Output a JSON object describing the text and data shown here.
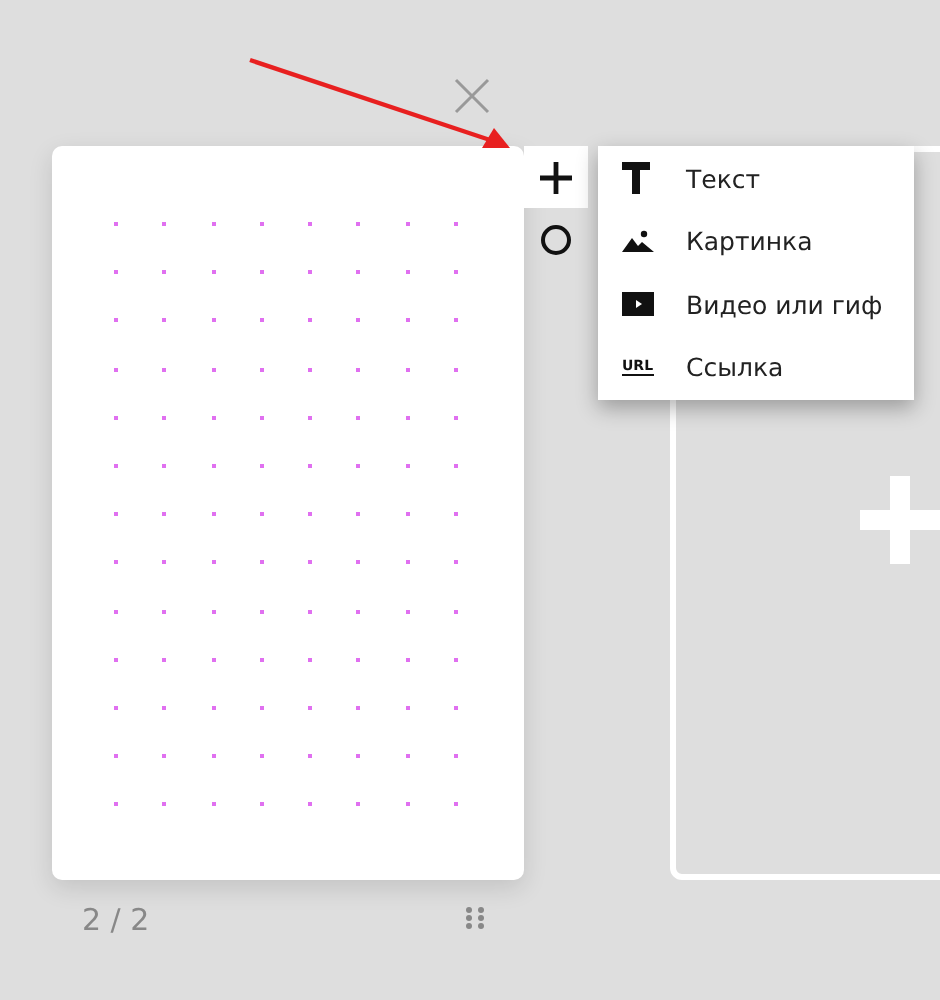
{
  "toolbar": [
    {
      "kind": "add",
      "selected": true
    },
    {
      "kind": "shape",
      "selected": false
    }
  ],
  "add_menu": [
    {
      "kind": "text",
      "label": "Текст"
    },
    {
      "kind": "image",
      "label": "Картинка"
    },
    {
      "kind": "video",
      "label": "Видео или гиф"
    },
    {
      "kind": "link",
      "label": "Ссылка",
      "icon_text": "URL"
    }
  ],
  "page_indicator": "2 / 2"
}
